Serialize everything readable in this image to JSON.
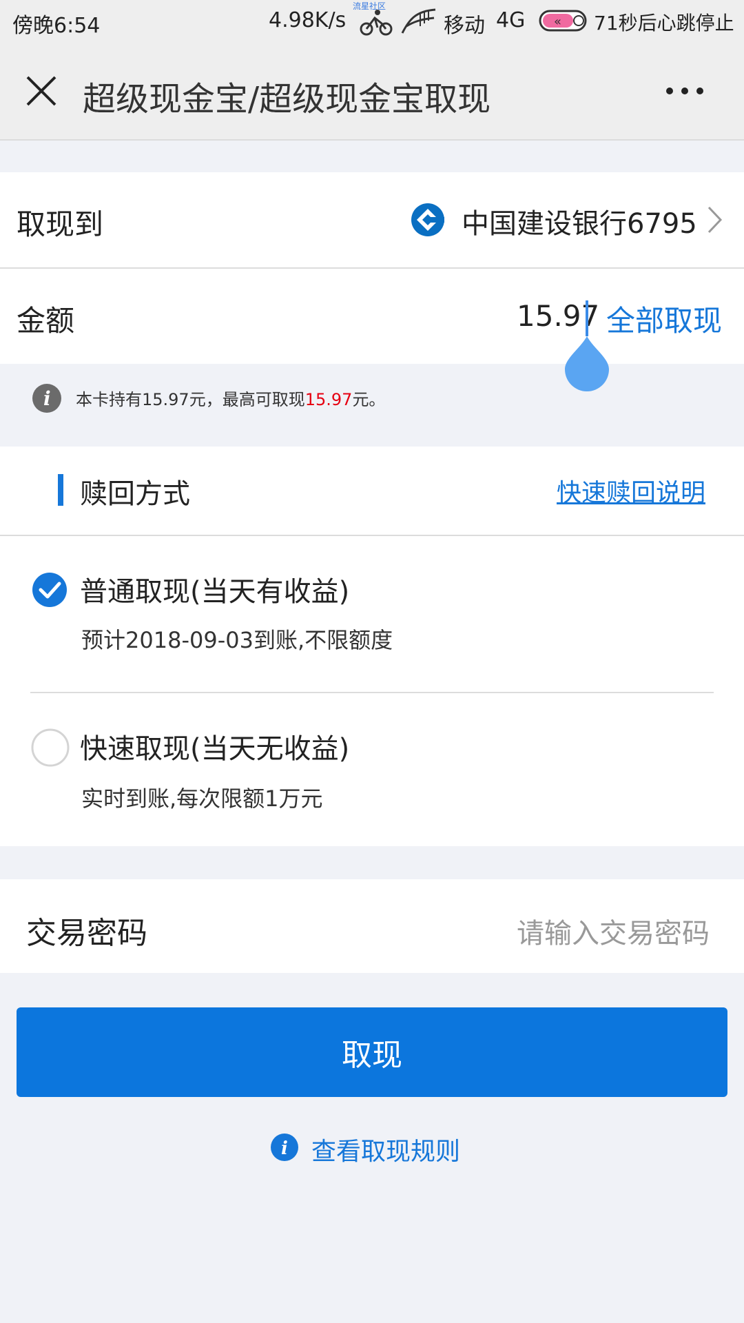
{
  "status_bar": {
    "time": "傍晚6:54",
    "speed": "4.98K/s",
    "tiny_label": "流星社区",
    "carrier": "移动",
    "network": "4G",
    "heartbeat": "71秒后心跳停止"
  },
  "nav": {
    "title": "超级现金宝/超级现金宝取现"
  },
  "withdraw_to": {
    "label": "取现到",
    "bank": "中国建设银行6795"
  },
  "amount": {
    "label": "金额",
    "value": "15.97",
    "withdraw_all": "全部取现"
  },
  "hint": {
    "prefix": "本卡持有15.97元，最高可取现",
    "max": "15.97",
    "suffix": "元。"
  },
  "redeem": {
    "title": "赎回方式",
    "help_link": "快速赎回说明",
    "options": [
      {
        "title": "普通取现(当天有收益)",
        "desc": "预计2018-09-03到账,不限额度",
        "selected": true
      },
      {
        "title": "快速取现(当天无收益)",
        "desc": "实时到账,每次限额1万元",
        "selected": false
      }
    ]
  },
  "password": {
    "label": "交易密码",
    "placeholder": "请输入交易密码"
  },
  "submit_label": "取现",
  "rules_link": "查看取现规则",
  "colors": {
    "accent": "#0c76dd",
    "link": "#1677d9",
    "highlight": "#e60012"
  }
}
